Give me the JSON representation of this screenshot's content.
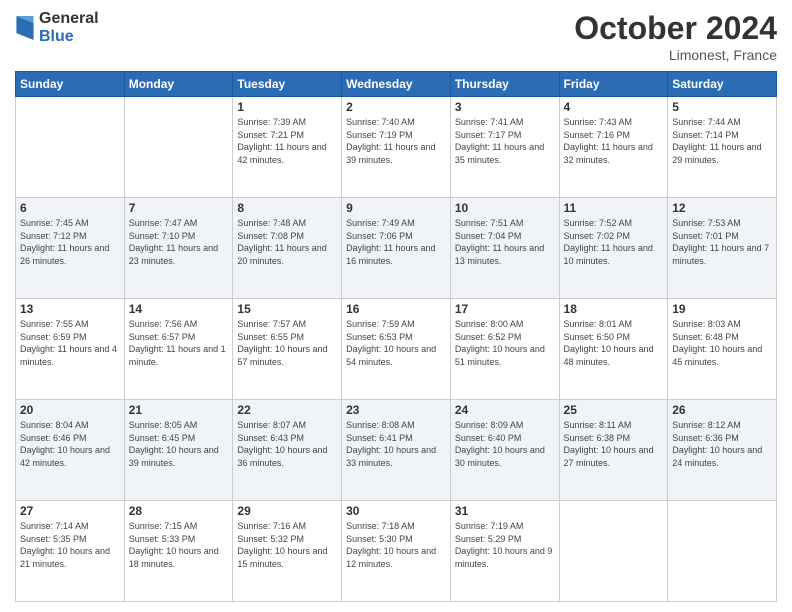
{
  "header": {
    "logo_general": "General",
    "logo_blue": "Blue",
    "month": "October 2024",
    "location": "Limonest, France"
  },
  "days_of_week": [
    "Sunday",
    "Monday",
    "Tuesday",
    "Wednesday",
    "Thursday",
    "Friday",
    "Saturday"
  ],
  "weeks": [
    [
      {
        "day": "",
        "sunrise": "",
        "sunset": "",
        "daylight": ""
      },
      {
        "day": "",
        "sunrise": "",
        "sunset": "",
        "daylight": ""
      },
      {
        "day": "1",
        "sunrise": "Sunrise: 7:39 AM",
        "sunset": "Sunset: 7:21 PM",
        "daylight": "Daylight: 11 hours and 42 minutes."
      },
      {
        "day": "2",
        "sunrise": "Sunrise: 7:40 AM",
        "sunset": "Sunset: 7:19 PM",
        "daylight": "Daylight: 11 hours and 39 minutes."
      },
      {
        "day": "3",
        "sunrise": "Sunrise: 7:41 AM",
        "sunset": "Sunset: 7:17 PM",
        "daylight": "Daylight: 11 hours and 35 minutes."
      },
      {
        "day": "4",
        "sunrise": "Sunrise: 7:43 AM",
        "sunset": "Sunset: 7:16 PM",
        "daylight": "Daylight: 11 hours and 32 minutes."
      },
      {
        "day": "5",
        "sunrise": "Sunrise: 7:44 AM",
        "sunset": "Sunset: 7:14 PM",
        "daylight": "Daylight: 11 hours and 29 minutes."
      }
    ],
    [
      {
        "day": "6",
        "sunrise": "Sunrise: 7:45 AM",
        "sunset": "Sunset: 7:12 PM",
        "daylight": "Daylight: 11 hours and 26 minutes."
      },
      {
        "day": "7",
        "sunrise": "Sunrise: 7:47 AM",
        "sunset": "Sunset: 7:10 PM",
        "daylight": "Daylight: 11 hours and 23 minutes."
      },
      {
        "day": "8",
        "sunrise": "Sunrise: 7:48 AM",
        "sunset": "Sunset: 7:08 PM",
        "daylight": "Daylight: 11 hours and 20 minutes."
      },
      {
        "day": "9",
        "sunrise": "Sunrise: 7:49 AM",
        "sunset": "Sunset: 7:06 PM",
        "daylight": "Daylight: 11 hours and 16 minutes."
      },
      {
        "day": "10",
        "sunrise": "Sunrise: 7:51 AM",
        "sunset": "Sunset: 7:04 PM",
        "daylight": "Daylight: 11 hours and 13 minutes."
      },
      {
        "day": "11",
        "sunrise": "Sunrise: 7:52 AM",
        "sunset": "Sunset: 7:02 PM",
        "daylight": "Daylight: 11 hours and 10 minutes."
      },
      {
        "day": "12",
        "sunrise": "Sunrise: 7:53 AM",
        "sunset": "Sunset: 7:01 PM",
        "daylight": "Daylight: 11 hours and 7 minutes."
      }
    ],
    [
      {
        "day": "13",
        "sunrise": "Sunrise: 7:55 AM",
        "sunset": "Sunset: 6:59 PM",
        "daylight": "Daylight: 11 hours and 4 minutes."
      },
      {
        "day": "14",
        "sunrise": "Sunrise: 7:56 AM",
        "sunset": "Sunset: 6:57 PM",
        "daylight": "Daylight: 11 hours and 1 minute."
      },
      {
        "day": "15",
        "sunrise": "Sunrise: 7:57 AM",
        "sunset": "Sunset: 6:55 PM",
        "daylight": "Daylight: 10 hours and 57 minutes."
      },
      {
        "day": "16",
        "sunrise": "Sunrise: 7:59 AM",
        "sunset": "Sunset: 6:53 PM",
        "daylight": "Daylight: 10 hours and 54 minutes."
      },
      {
        "day": "17",
        "sunrise": "Sunrise: 8:00 AM",
        "sunset": "Sunset: 6:52 PM",
        "daylight": "Daylight: 10 hours and 51 minutes."
      },
      {
        "day": "18",
        "sunrise": "Sunrise: 8:01 AM",
        "sunset": "Sunset: 6:50 PM",
        "daylight": "Daylight: 10 hours and 48 minutes."
      },
      {
        "day": "19",
        "sunrise": "Sunrise: 8:03 AM",
        "sunset": "Sunset: 6:48 PM",
        "daylight": "Daylight: 10 hours and 45 minutes."
      }
    ],
    [
      {
        "day": "20",
        "sunrise": "Sunrise: 8:04 AM",
        "sunset": "Sunset: 6:46 PM",
        "daylight": "Daylight: 10 hours and 42 minutes."
      },
      {
        "day": "21",
        "sunrise": "Sunrise: 8:05 AM",
        "sunset": "Sunset: 6:45 PM",
        "daylight": "Daylight: 10 hours and 39 minutes."
      },
      {
        "day": "22",
        "sunrise": "Sunrise: 8:07 AM",
        "sunset": "Sunset: 6:43 PM",
        "daylight": "Daylight: 10 hours and 36 minutes."
      },
      {
        "day": "23",
        "sunrise": "Sunrise: 8:08 AM",
        "sunset": "Sunset: 6:41 PM",
        "daylight": "Daylight: 10 hours and 33 minutes."
      },
      {
        "day": "24",
        "sunrise": "Sunrise: 8:09 AM",
        "sunset": "Sunset: 6:40 PM",
        "daylight": "Daylight: 10 hours and 30 minutes."
      },
      {
        "day": "25",
        "sunrise": "Sunrise: 8:11 AM",
        "sunset": "Sunset: 6:38 PM",
        "daylight": "Daylight: 10 hours and 27 minutes."
      },
      {
        "day": "26",
        "sunrise": "Sunrise: 8:12 AM",
        "sunset": "Sunset: 6:36 PM",
        "daylight": "Daylight: 10 hours and 24 minutes."
      }
    ],
    [
      {
        "day": "27",
        "sunrise": "Sunrise: 7:14 AM",
        "sunset": "Sunset: 5:35 PM",
        "daylight": "Daylight: 10 hours and 21 minutes."
      },
      {
        "day": "28",
        "sunrise": "Sunrise: 7:15 AM",
        "sunset": "Sunset: 5:33 PM",
        "daylight": "Daylight: 10 hours and 18 minutes."
      },
      {
        "day": "29",
        "sunrise": "Sunrise: 7:16 AM",
        "sunset": "Sunset: 5:32 PM",
        "daylight": "Daylight: 10 hours and 15 minutes."
      },
      {
        "day": "30",
        "sunrise": "Sunrise: 7:18 AM",
        "sunset": "Sunset: 5:30 PM",
        "daylight": "Daylight: 10 hours and 12 minutes."
      },
      {
        "day": "31",
        "sunrise": "Sunrise: 7:19 AM",
        "sunset": "Sunset: 5:29 PM",
        "daylight": "Daylight: 10 hours and 9 minutes."
      },
      {
        "day": "",
        "sunrise": "",
        "sunset": "",
        "daylight": ""
      },
      {
        "day": "",
        "sunrise": "",
        "sunset": "",
        "daylight": ""
      }
    ]
  ]
}
